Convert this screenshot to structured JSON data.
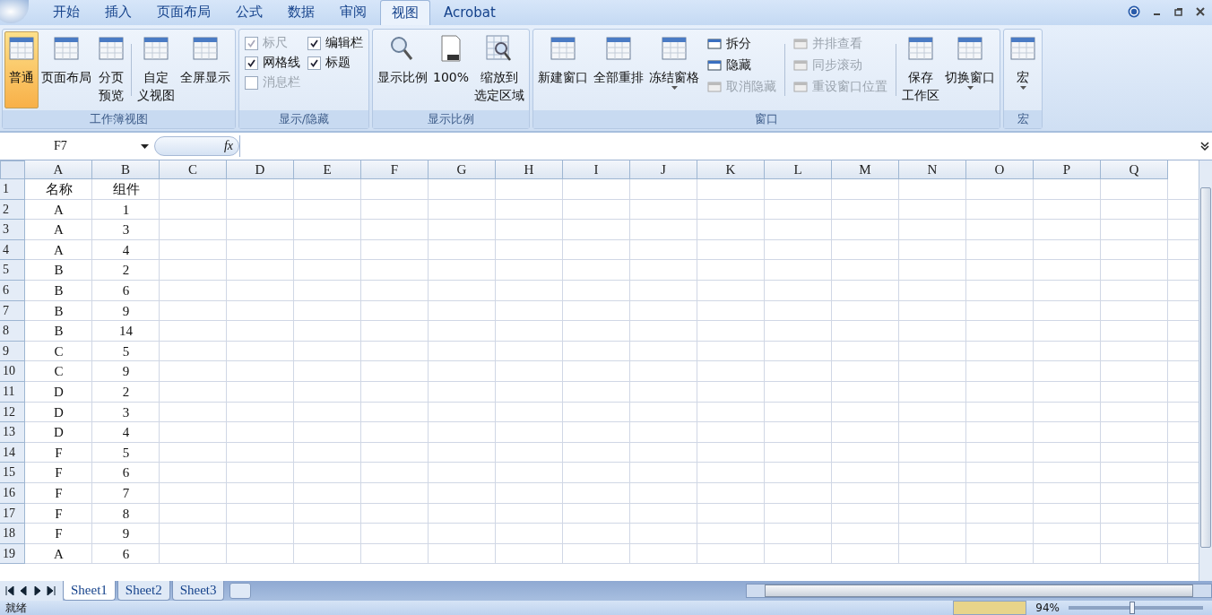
{
  "tabs": [
    {
      "label": "开始",
      "selected": false
    },
    {
      "label": "插入",
      "selected": false
    },
    {
      "label": "页面布局",
      "selected": false
    },
    {
      "label": "公式",
      "selected": false
    },
    {
      "label": "数据",
      "selected": false
    },
    {
      "label": "审阅",
      "selected": false
    },
    {
      "label": "视图",
      "selected": true
    },
    {
      "label": "Acrobat",
      "selected": false
    }
  ],
  "ribbon": {
    "groups": [
      {
        "title": "工作簿视图",
        "items": [
          {
            "kind": "large",
            "lines": [
              "普通"
            ],
            "selected": true
          },
          {
            "kind": "large",
            "lines": [
              "页面布局"
            ],
            "selected": false
          },
          {
            "kind": "large",
            "lines": [
              "分页",
              "预览"
            ],
            "selected": false
          },
          {
            "kind": "separator"
          },
          {
            "kind": "large",
            "lines": [
              "自定",
              "义视图"
            ],
            "selected": false
          },
          {
            "kind": "large",
            "lines": [
              "全屏显示"
            ],
            "selected": false
          }
        ]
      },
      {
        "title": "显示/隐藏",
        "items": [
          {
            "kind": "checks",
            "checks": [
              {
                "label": "标尺",
                "checked": true,
                "disabled": true
              },
              {
                "label": "网格线",
                "checked": true,
                "disabled": false
              },
              {
                "label": "消息栏",
                "checked": false,
                "disabled": true
              }
            ]
          },
          {
            "kind": "checks",
            "checks": [
              {
                "label": "编辑栏",
                "checked": true,
                "disabled": false
              },
              {
                "label": "标题",
                "checked": true,
                "disabled": false
              }
            ]
          }
        ]
      },
      {
        "title": "显示比例",
        "items": [
          {
            "kind": "zoom",
            "lines": [
              "显示比例"
            ],
            "selected": false
          },
          {
            "kind": "page",
            "lines": [
              "100%"
            ],
            "selected": false
          },
          {
            "kind": "zoomsel",
            "lines": [
              "缩放到",
              "选定区域"
            ],
            "selected": false
          }
        ]
      },
      {
        "title": "窗口",
        "items": [
          {
            "kind": "large",
            "lines": [
              "新建窗口"
            ],
            "selected": false
          },
          {
            "kind": "large",
            "lines": [
              "全部重排"
            ],
            "selected": false
          },
          {
            "kind": "large",
            "lines": [
              "冻结窗格"
            ],
            "selected": false,
            "dropdown": true
          },
          {
            "kind": "small",
            "entries": [
              {
                "label": "拆分",
                "disabled": false
              },
              {
                "label": "隐藏",
                "disabled": false
              },
              {
                "label": "取消隐藏",
                "disabled": true
              }
            ]
          },
          {
            "kind": "separator"
          },
          {
            "kind": "small",
            "entries": [
              {
                "label": "并排查看",
                "disabled": true
              },
              {
                "label": "同步滚动",
                "disabled": true
              },
              {
                "label": "重设窗口位置",
                "disabled": true
              }
            ]
          },
          {
            "kind": "separator"
          },
          {
            "kind": "large",
            "lines": [
              "保存",
              "工作区"
            ],
            "selected": false
          },
          {
            "kind": "large",
            "lines": [
              "切换窗口"
            ],
            "selected": false,
            "dropdown": true
          }
        ]
      },
      {
        "title": "宏",
        "items": [
          {
            "kind": "large",
            "lines": [
              "宏"
            ],
            "selected": false,
            "dropdown": true
          }
        ]
      }
    ]
  },
  "name_box": "F7",
  "fx": "fx",
  "columns": [
    "A",
    "B",
    "C",
    "D",
    "E",
    "F",
    "G",
    "H",
    "I",
    "J",
    "K",
    "L",
    "M",
    "N",
    "O",
    "P",
    "Q"
  ],
  "rows": [
    {
      "n": "1",
      "cells": [
        "名称",
        "组件"
      ]
    },
    {
      "n": "2",
      "cells": [
        "A",
        "1"
      ]
    },
    {
      "n": "3",
      "cells": [
        "A",
        "3"
      ]
    },
    {
      "n": "4",
      "cells": [
        "A",
        "4"
      ]
    },
    {
      "n": "5",
      "cells": [
        "B",
        "2"
      ]
    },
    {
      "n": "6",
      "cells": [
        "B",
        "6"
      ]
    },
    {
      "n": "7",
      "cells": [
        "B",
        "9"
      ]
    },
    {
      "n": "8",
      "cells": [
        "B",
        "14"
      ]
    },
    {
      "n": "9",
      "cells": [
        "C",
        "5"
      ]
    },
    {
      "n": "10",
      "cells": [
        "C",
        "9"
      ]
    },
    {
      "n": "11",
      "cells": [
        "D",
        "2"
      ]
    },
    {
      "n": "12",
      "cells": [
        "D",
        "3"
      ]
    },
    {
      "n": "13",
      "cells": [
        "D",
        "4"
      ]
    },
    {
      "n": "14",
      "cells": [
        "F",
        "5"
      ]
    },
    {
      "n": "15",
      "cells": [
        "F",
        "6"
      ]
    },
    {
      "n": "16",
      "cells": [
        "F",
        "7"
      ]
    },
    {
      "n": "17",
      "cells": [
        "F",
        "8"
      ]
    },
    {
      "n": "18",
      "cells": [
        "F",
        "9"
      ]
    },
    {
      "n": "19",
      "cells": [
        "A",
        "6"
      ]
    }
  ],
  "sheets": [
    {
      "label": "Sheet1",
      "selected": true
    },
    {
      "label": "Sheet2",
      "selected": false
    },
    {
      "label": "Sheet3",
      "selected": false
    }
  ],
  "status_bar": {
    "text": "就绪",
    "zoom": "94%",
    "zoom_slider": {
      "level": 0.47
    }
  }
}
